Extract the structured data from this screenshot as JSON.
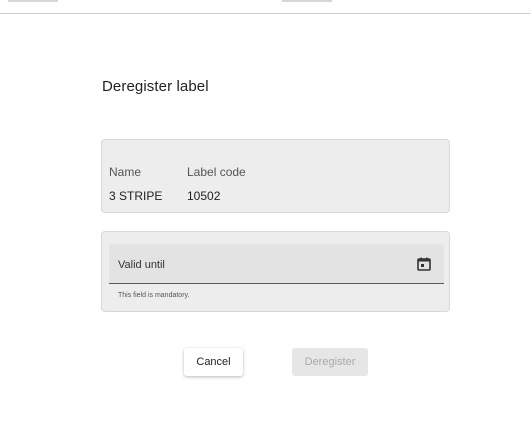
{
  "dialog": {
    "title": "Deregister label"
  },
  "label_info": {
    "name_header": "Name",
    "code_header": "Label code",
    "name_value": "3 STRIPE",
    "code_value": "10502"
  },
  "valid_until": {
    "label": "Valid until",
    "value": "",
    "hint": "This field is mandatory.",
    "icon": "calendar-icon"
  },
  "actions": {
    "cancel_label": "Cancel",
    "deregister_label": "Deregister"
  },
  "colors": {
    "card_background": "#ededed",
    "field_background": "#e3e3e3",
    "disabled_text": "#a9a9a9"
  }
}
